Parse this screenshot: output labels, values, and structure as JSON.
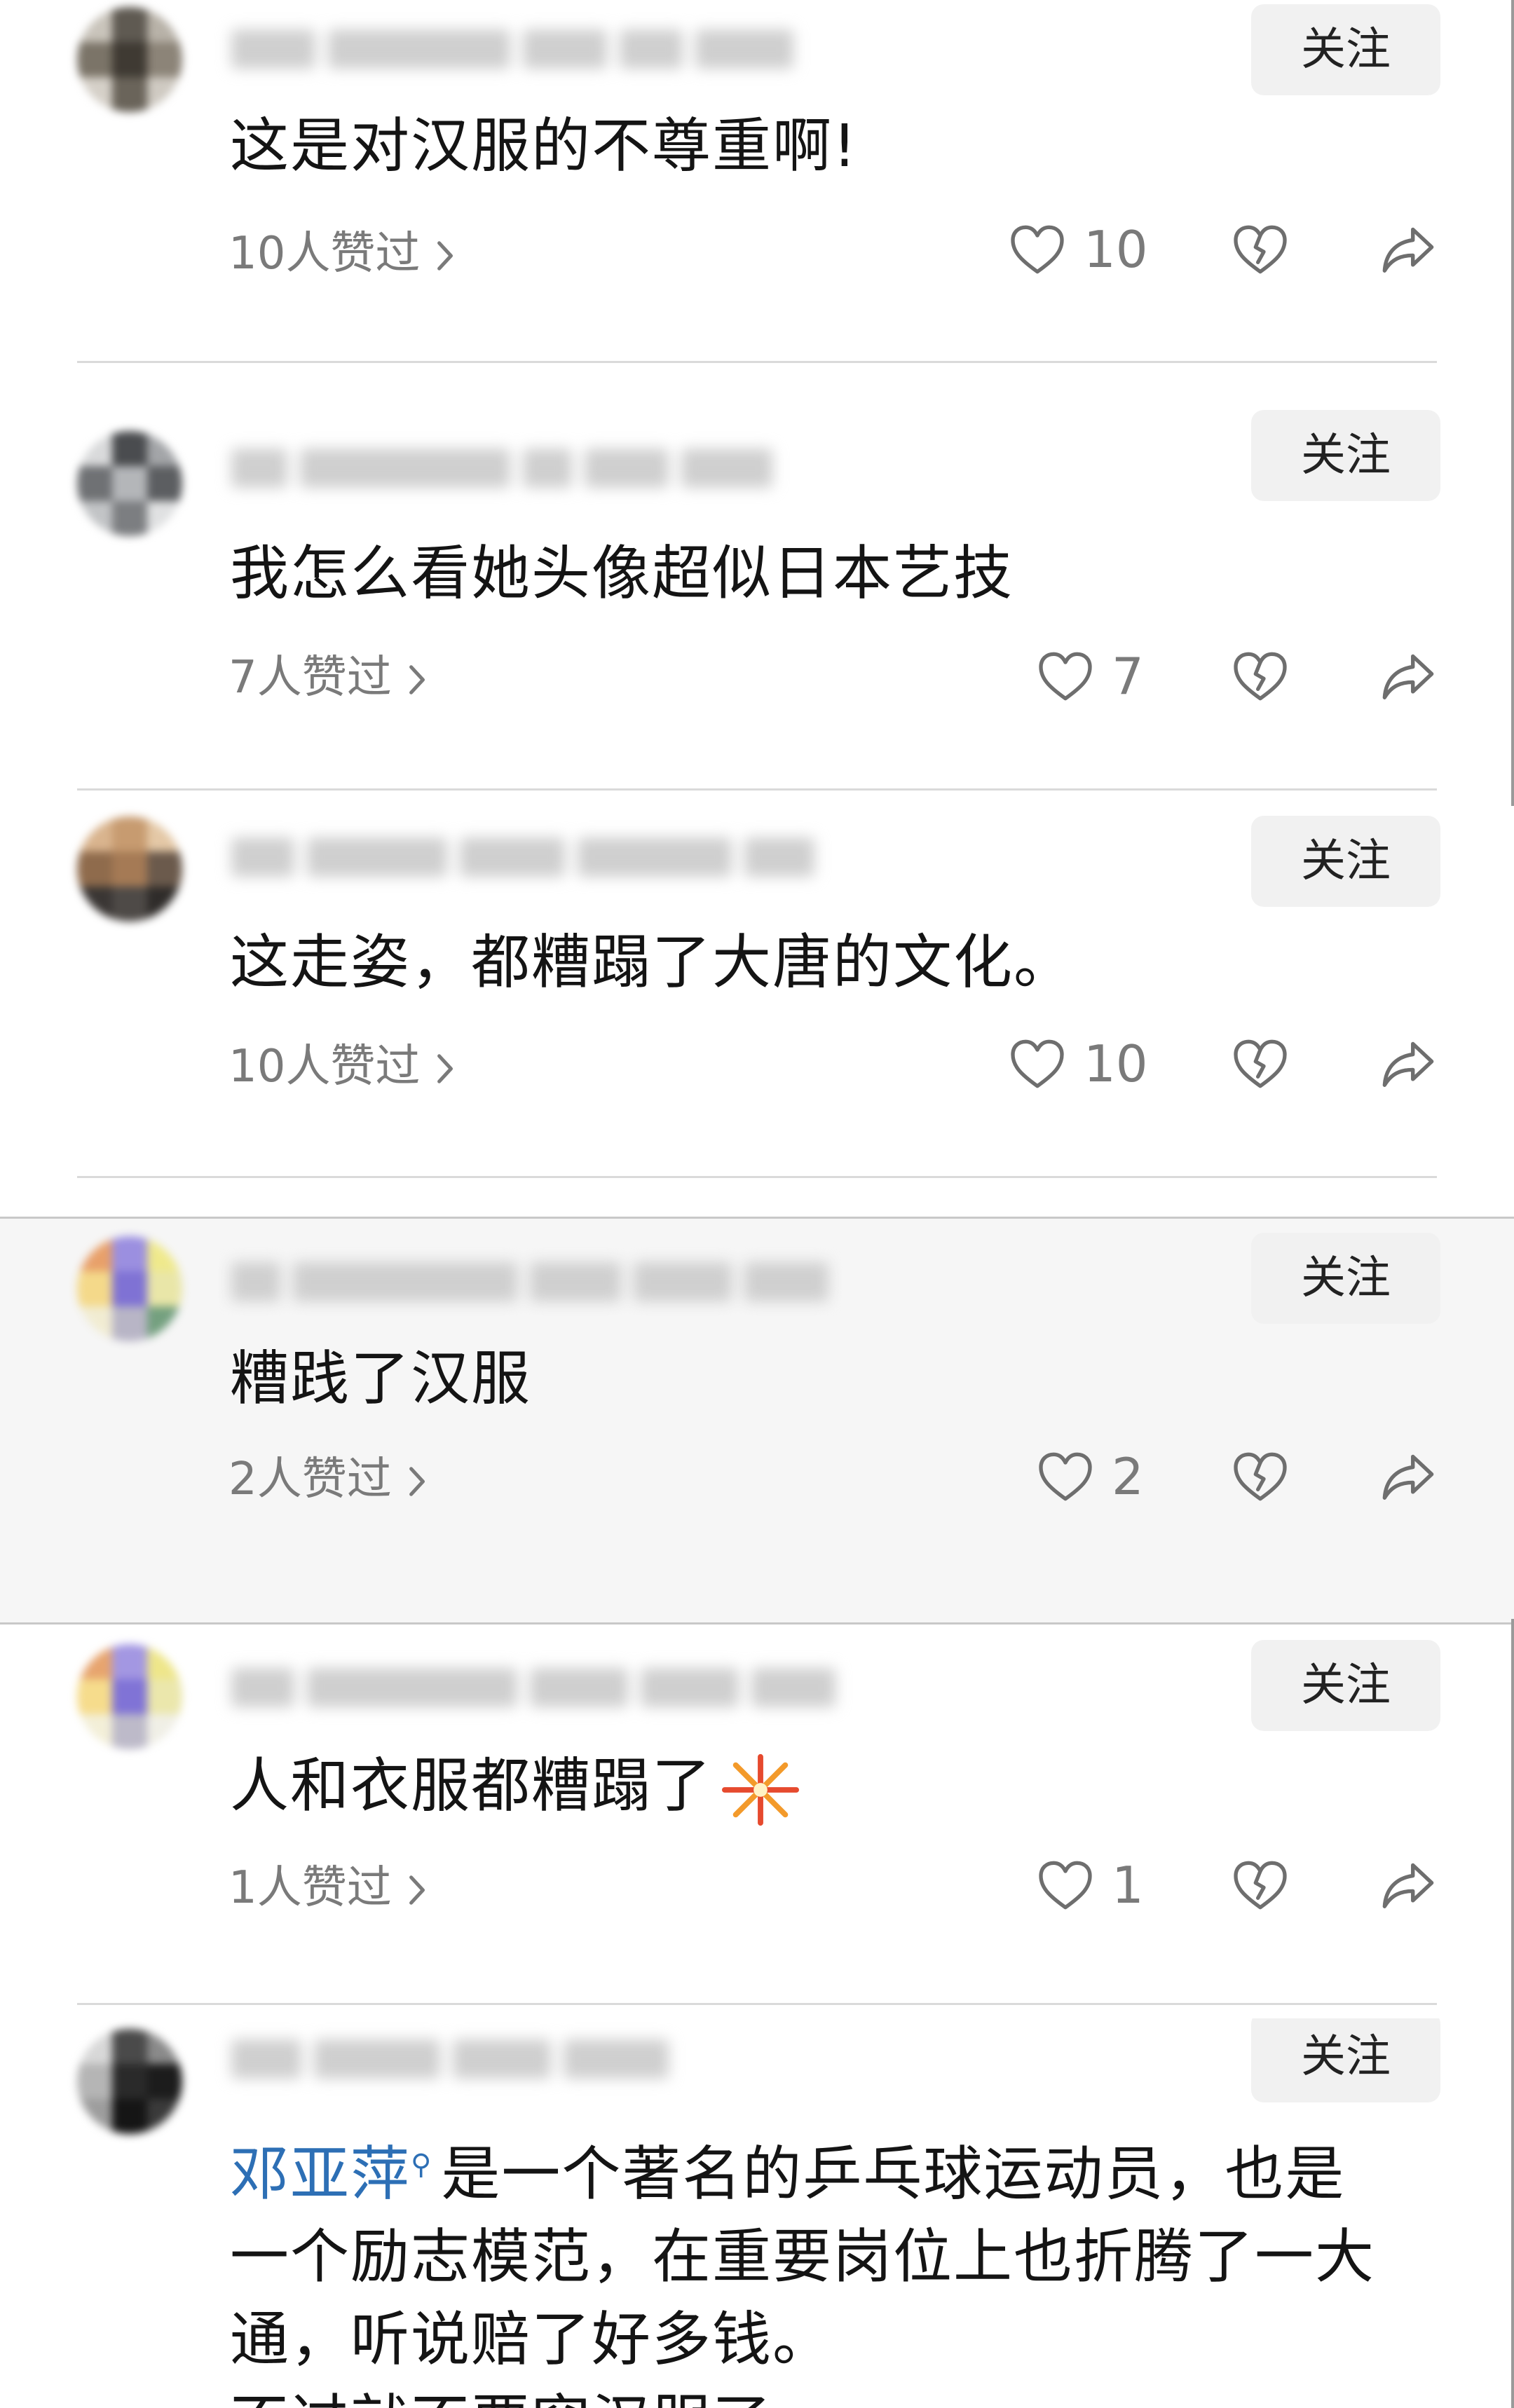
{
  "follow_label": "关注",
  "comments": [
    {
      "text": "这是对汉服的不尊重啊!",
      "liked_by": "10人赞过",
      "like_count": "10"
    },
    {
      "text": "我怎么看她头像超似日本艺技",
      "liked_by": "7人赞过",
      "like_count": "7"
    },
    {
      "text": "这走姿，都糟蹋了大唐的文化。",
      "liked_by": "10人赞过",
      "like_count": "10"
    },
    {
      "text": "糟践了汉服",
      "liked_by": "2人赞过",
      "like_count": "2"
    },
    {
      "text": "人和衣服都糟蹋了",
      "liked_by": "1人赞过",
      "like_count": "1"
    },
    {
      "mention": "邓亚萍",
      "text_line1": "是一个著名的乒乓球运动员，也是",
      "text_line2": "一个励志模范，在重要岗位上也折腾了一大",
      "text_line3": "通，听说赔了好多钱。",
      "text_line4": "不过就不要穿汉服了"
    }
  ],
  "icons": {
    "like": "heart-outline-icon",
    "dislike": "broken-heart-icon",
    "share": "share-arrow-icon",
    "chevron": "chevron-right-icon",
    "emoji": "firecracker-emoji-icon"
  },
  "colors": {
    "mention": "#2d6fb5",
    "muted": "#7a7a7a",
    "follow_bg": "#f1f1f1"
  }
}
